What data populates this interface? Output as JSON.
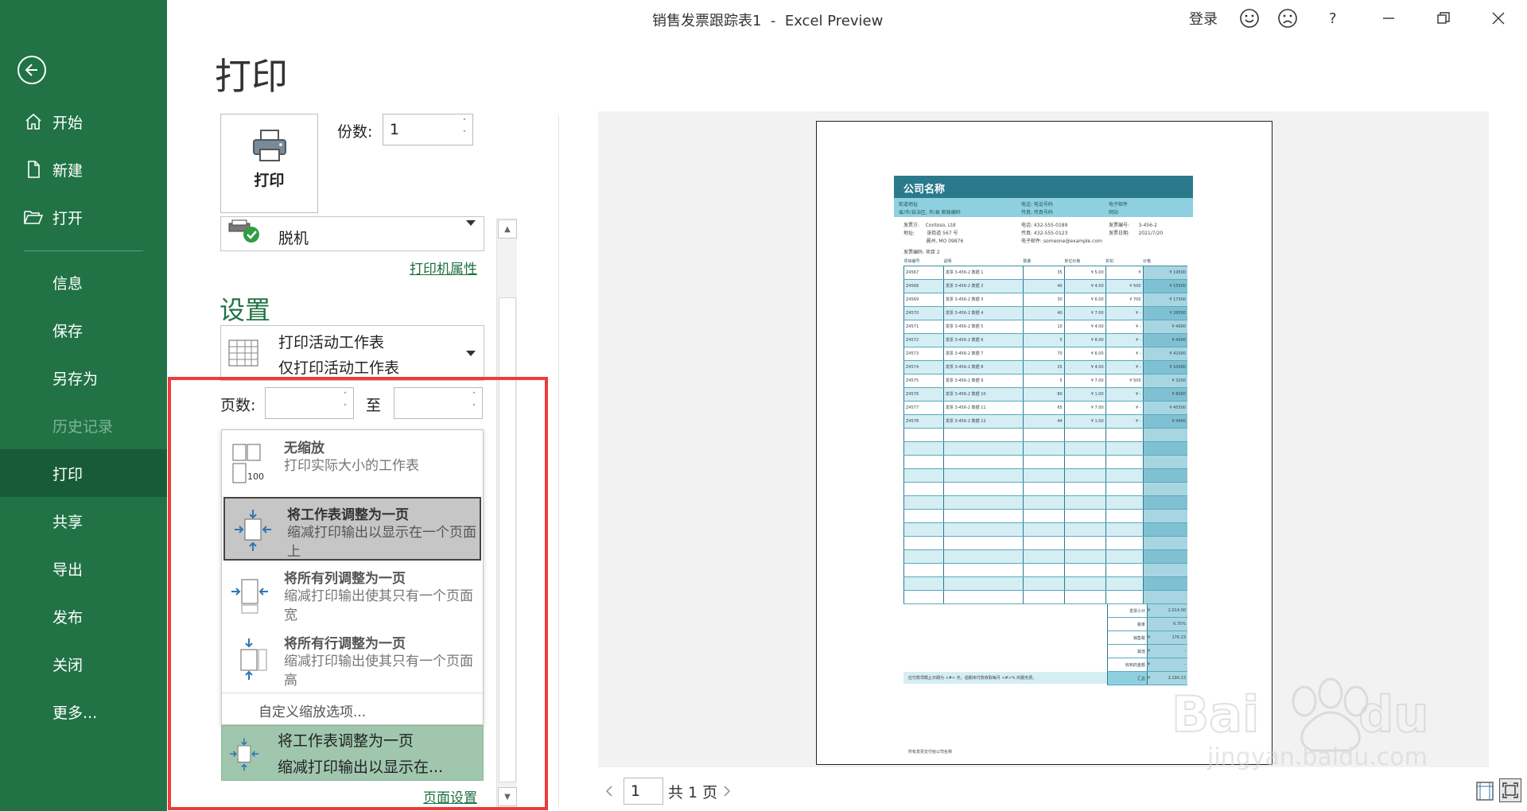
{
  "window": {
    "title": "销售发票跟踪表1  -  Excel Preview",
    "signin_label": "登录",
    "help_label": "?"
  },
  "sidebar": {
    "items": [
      {
        "label": "开始",
        "icon": "home-icon"
      },
      {
        "label": "新建",
        "icon": "new-document-icon"
      },
      {
        "label": "打开",
        "icon": "folder-open-icon"
      },
      {
        "label": "信息"
      },
      {
        "label": "保存"
      },
      {
        "label": "另存为"
      },
      {
        "label": "历史记录",
        "disabled": true
      },
      {
        "label": "打印",
        "active": true
      },
      {
        "label": "共享"
      },
      {
        "label": "导出"
      },
      {
        "label": "发布"
      },
      {
        "label": "关闭"
      },
      {
        "label": "更多..."
      }
    ]
  },
  "print": {
    "heading": "打印",
    "button_label": "打印",
    "copies_label": "份数:",
    "copies_value": "1",
    "printer_name": "脱机",
    "printer_properties_link": "打印机属性",
    "settings_heading": "设置",
    "what_to_print": {
      "title": "打印活动工作表",
      "subtitle": "仅打印活动工作表"
    },
    "pages_label": "页数:",
    "pages_to_label": "至",
    "pages_from_value": "",
    "pages_to_value": "",
    "scaling_options": [
      {
        "title": "无缩放",
        "desc": "打印实际大小的工作表",
        "icon": "no-scaling-icon",
        "icon_text": "100"
      },
      {
        "title": "将工作表调整为一页",
        "desc": "缩减打印输出以显示在一个页面上",
        "icon": "fit-sheet-icon",
        "selected": true
      },
      {
        "title": "将所有列调整为一页",
        "desc": "缩减打印输出使其只有一个页面宽",
        "icon": "fit-columns-icon"
      },
      {
        "title": "将所有行调整为一页",
        "desc": "缩减打印输出使其只有一个页面高",
        "icon": "fit-rows-icon"
      }
    ],
    "custom_scaling_label": "自定义缩放选项...",
    "current_scaling": {
      "title": "将工作表调整为一页",
      "subtitle": "缩减打印输出以显示在..."
    },
    "page_setup_link": "页面设置"
  },
  "preview": {
    "page_number": "1",
    "page_total": "共 1 页",
    "invoice": {
      "company": "公司名称",
      "sub_left": "街道地址\n省/市/自治区, 市/县 邮政编码",
      "sub_mid": "电话: 电话号码\n传真: 传真号码",
      "sub_right": "电子邮件\n网站",
      "billto_left": "发票方:    Contoso, Ltd\n地址:        张街道 567 号\n               晨州, MO 09876",
      "billto_mid": "电话: 432-555-0189\n传真: 432-555-0123\n电子邮件: someone@example.com",
      "billto_right": "发票编号:      3-456-2\n发票日期:      2021/7/20",
      "invoice_note": "发票编码: 项目 2",
      "headers": [
        "项目编号",
        "说明",
        "数量",
        "单位价格",
        "折扣",
        "价格"
      ],
      "rows": [
        [
          "Z4567",
          "发票 3-456-2 数据 1",
          "35",
          "¥",
          "5.00",
          "¥",
          "",
          "¥",
          "19500"
        ],
        [
          "Z4568",
          "发票 3-456-2 数据 2",
          "40",
          "¥",
          "4.00",
          "¥",
          "500",
          "¥",
          "15500"
        ],
        [
          "Z4569",
          "发票 3-456-2 数据 3",
          "30",
          "¥",
          "6.00",
          "¥",
          "700",
          "¥",
          "17300"
        ],
        [
          "Z4570",
          "发票 3-456-2 数据 4",
          "40",
          "¥",
          "7.00",
          "¥",
          "-",
          "¥",
          "28000"
        ],
        [
          "Z4571",
          "发票 3-456-2 数据 5",
          "10",
          "¥",
          "4.00",
          "¥",
          "-",
          "¥",
          "4000"
        ],
        [
          "Z4572",
          "发票 3-456-2 数据 6",
          "5",
          "¥",
          "8.00",
          "¥",
          "-",
          "¥",
          "4000"
        ],
        [
          "Z4573",
          "发票 3-456-2 数据 7",
          "70",
          "¥",
          "6.00",
          "¥",
          "-",
          "¥",
          "42000"
        ],
        [
          "Z4574",
          "发票 3-456-2 数据 8",
          "25",
          "¥",
          "4.00",
          "¥",
          "-",
          "¥",
          "10000"
        ],
        [
          "Z4575",
          "发票 3-456-2 数据 9",
          "5",
          "¥",
          "7.00",
          "¥",
          "500",
          "¥",
          "3200"
        ],
        [
          "Z4576",
          "发票 3-456-2 数据 10",
          "80",
          "¥",
          "1.00",
          "¥",
          "-",
          "¥",
          "8000"
        ],
        [
          "Z4577",
          "发票 3-456-2 数据 11",
          "65",
          "¥",
          "7.00",
          "¥",
          "-",
          "¥",
          "45500"
        ],
        [
          "Z4578",
          "发票 3-456-2 数据 12",
          "44",
          "¥",
          "1.00",
          "¥",
          "-",
          "¥",
          "4400"
        ]
      ],
      "empty_rows": 13,
      "totals": [
        [
          "发票小计",
          "¥",
          "2,014.00"
        ],
        [
          "税率",
          "",
          "6.75%"
        ],
        [
          "销售税",
          "¥",
          "176.23"
        ],
        [
          "其他",
          "¥",
          "-"
        ],
        [
          "收到的金额",
          "¥",
          "-"
        ],
        [
          "汇总",
          "¥",
          "2,190.23"
        ]
      ],
      "footer_1": "所有发票支付给公司名称",
      "footer_2": "应付款项截止日期为 <#> 天。逾期未付款收取每月 <#>% 的服务费。"
    }
  },
  "colors": {
    "sidebar": "#217346",
    "sidebar_active": "#185c37",
    "accent_green": "#217346",
    "annotation_red": "#ec3c3c",
    "invoice_teal": "#2a7a8c"
  }
}
